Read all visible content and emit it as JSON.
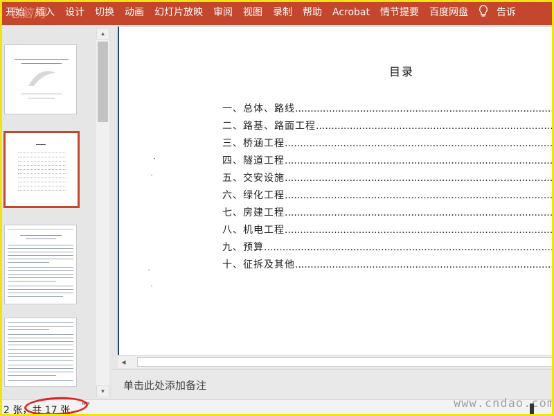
{
  "ribbon": {
    "tabs": [
      "开始",
      "插入",
      "设计",
      "切换",
      "动画",
      "幻灯片放映",
      "审阅",
      "视图",
      "录制",
      "帮助",
      "Acrobat",
      "情节提要",
      "百度网盘"
    ],
    "bulb_icon": "lightbulb-icon",
    "tell_me": "告诉"
  },
  "watermark_top": "电脑网",
  "slide": {
    "title": "目录",
    "toc": [
      "一、总体、路线",
      "二、路基、路面工程",
      "三、桥涵工程",
      "四、隧道工程",
      "五、交安设施",
      "六、绿化工程",
      "七、房建工程",
      "八、机电工程",
      "九、预算",
      "十、征拆及其他"
    ],
    "leader": "............................................................................................................................"
  },
  "notes": {
    "placeholder": "单击此处添加备注"
  },
  "status": {
    "slide_count": "2 张，共 17 张",
    "language": "\"\""
  },
  "watermark_bottom": "www.cndao.com",
  "colors": {
    "ribbon": "#c4462d",
    "highlight_circle": "#e02020",
    "frame": "#f2e30b"
  }
}
